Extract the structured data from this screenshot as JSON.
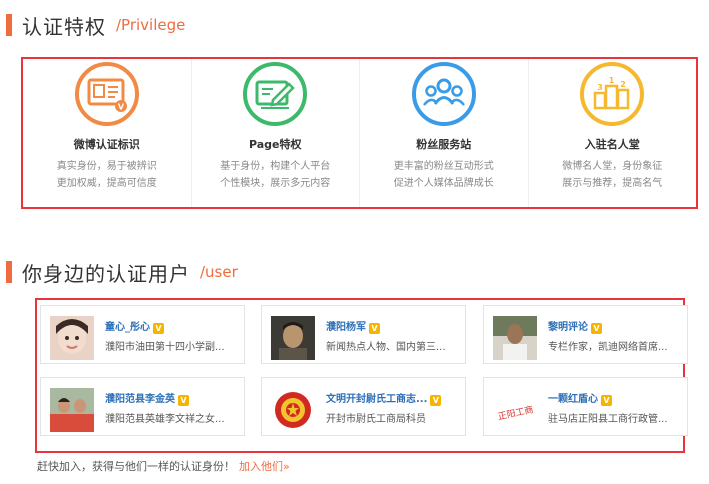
{
  "privilege_section": {
    "title": "认证特权",
    "subtitle": "/Privilege",
    "items": [
      {
        "title": "微博认证标识",
        "desc1": "真实身份，易于被辨识",
        "desc2": "更加权威，提高可信度",
        "color": "#f18a44"
      },
      {
        "title": "Page特权",
        "desc1": "基于身份，构建个人平台",
        "desc2": "个性模块，展示多元内容",
        "color": "#3cb96a"
      },
      {
        "title": "粉丝服务站",
        "desc1": "更丰富的粉丝互动形式",
        "desc2": "促进个人媒体品牌成长",
        "color": "#3a9be6"
      },
      {
        "title": "入驻名人堂",
        "desc1": "微博名人堂，身份象征",
        "desc2": "展示与推荐，提高名气",
        "color": "#f5b82e"
      }
    ]
  },
  "users_section": {
    "title": "你身边的认证用户",
    "subtitle": "/user",
    "users": [
      {
        "name": "童心_彤心",
        "desc": "濮阳市油田第十四小学副..."
      },
      {
        "name": "濮阳杨军",
        "desc": "新闻热点人物、国内第三..."
      },
      {
        "name": "黎明评论",
        "desc": "专栏作家，凯迪网络首席..."
      },
      {
        "name": "濮阳范县李金英",
        "desc": "濮阳范县英雄李文祥之女..."
      },
      {
        "name": "文明开封尉氏工商志...",
        "desc": "开封市尉氏工商局科员"
      },
      {
        "name": "一颗红盾心",
        "desc": "驻马店正阳县工商行政管..."
      }
    ],
    "verified_mark": "V",
    "stamp_text": "正阳工商"
  },
  "footer": {
    "text": "赶快加入，获得与他们一样的认证身份！",
    "link": "加入他们»"
  }
}
